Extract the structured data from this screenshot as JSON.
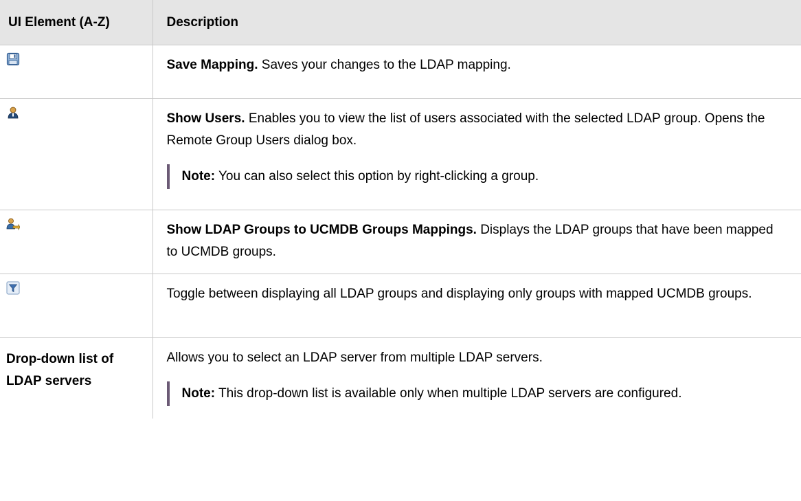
{
  "table": {
    "headers": {
      "element": "UI Element (A-Z)",
      "description": "Description"
    },
    "rows": [
      {
        "icon": "save-icon",
        "title": "Save Mapping.",
        "text": " Saves your changes to the LDAP mapping."
      },
      {
        "icon": "show-users-icon",
        "title": "Show Users.",
        "text": " Enables you to view the list of users associated with the selected LDAP group. Opens the Remote Group Users dialog box.",
        "note_label": "Note:",
        "note_text": "  You can also select this option by right-clicking a group."
      },
      {
        "icon": "group-mapping-icon",
        "title": "Show LDAP Groups to UCMDB Groups Mappings.",
        "text": " Displays the LDAP groups that have been mapped to UCMDB groups."
      },
      {
        "icon": "filter-icon",
        "text": "Toggle between displaying all LDAP groups and displaying only groups with mapped UCMDB groups."
      },
      {
        "element": "Drop-down list of LDAP servers",
        "text": "Allows you to select an LDAP server from multiple LDAP servers.",
        "note_label": "Note:",
        "note_text": "  This drop-down list is available only when multiple LDAP servers are configured."
      }
    ]
  },
  "colors": {
    "header_bg": "#e5e5e5",
    "grid": "#c8c8c8",
    "note_bar": "#6b5a75"
  }
}
